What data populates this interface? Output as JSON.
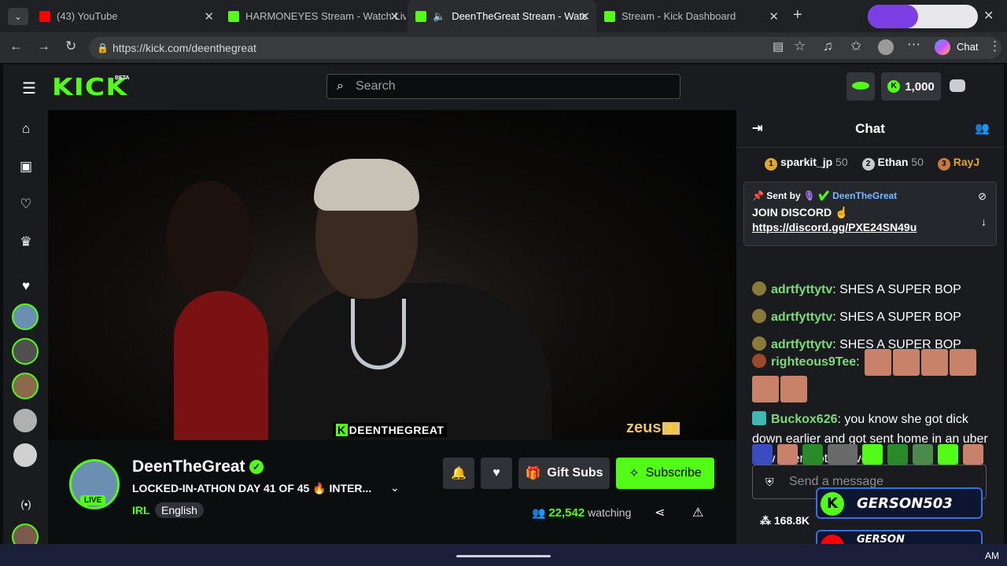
{
  "tabs": [
    {
      "title": "(43) YouTube",
      "fav": "#ff0000"
    },
    {
      "title": "HARMONEYES Stream - Watch Liv",
      "fav": "#53fc18"
    },
    {
      "title": "DeenTheGreat Stream - Watc",
      "fav": "#53fc18"
    },
    {
      "title": "Stream - Kick Dashboard",
      "fav": "#53fc18"
    }
  ],
  "browser": {
    "url": "https://kick.com/deenthegreat",
    "chat_btn": "Chat"
  },
  "header": {
    "logo": "KICK",
    "beta": "BETA",
    "search_placeholder": "Search",
    "points": "1,000"
  },
  "video": {
    "watermark": "DEENTHEGREAT",
    "sponsor": "zeus"
  },
  "channel": {
    "name": "DeenTheGreat",
    "live_label": "LIVE",
    "title": "LOCKED-IN-ATHON DAY 41 OF 45 🔥 INTER...",
    "category": "IRL",
    "language": "English",
    "gift_label": "Gift Subs",
    "subscribe_label": "Subscribe",
    "viewers": "22,542",
    "viewers_label": "watching"
  },
  "chat": {
    "title": "Chat",
    "top_gifters": [
      {
        "rank": "1",
        "name": "sparkit_jp",
        "score": "50"
      },
      {
        "rank": "2",
        "name": "Ethan",
        "score": "50"
      },
      {
        "rank": "3",
        "name": "RayJ",
        "score": ""
      }
    ],
    "pinned": {
      "sent_by": "Sent by",
      "author": "DeenTheGreat",
      "text": "JOIN DISCORD ☝️",
      "link": "https://discord.gg/PXE24SN49u"
    },
    "messages": [
      {
        "user": "adrtfyttytv",
        "text": "SHES A SUPER BOP"
      },
      {
        "user": "adrtfyttytv",
        "text": "SHES A SUPER BOP"
      },
      {
        "user": "adrtfyttytv",
        "text": "SHES A SUPER BOP"
      },
      {
        "user": "righteous9Tee",
        "text": ""
      },
      {
        "user": "Buckox626",
        "text": "you know she got dick down earlier and got sent home in an uber now deen got leftovers"
      }
    ],
    "send_placeholder": "Send a message",
    "followers": "168.8K",
    "overlay1": "GERSON503",
    "overlay2": "GERSON QUINTANILLA",
    "time": "AM"
  }
}
